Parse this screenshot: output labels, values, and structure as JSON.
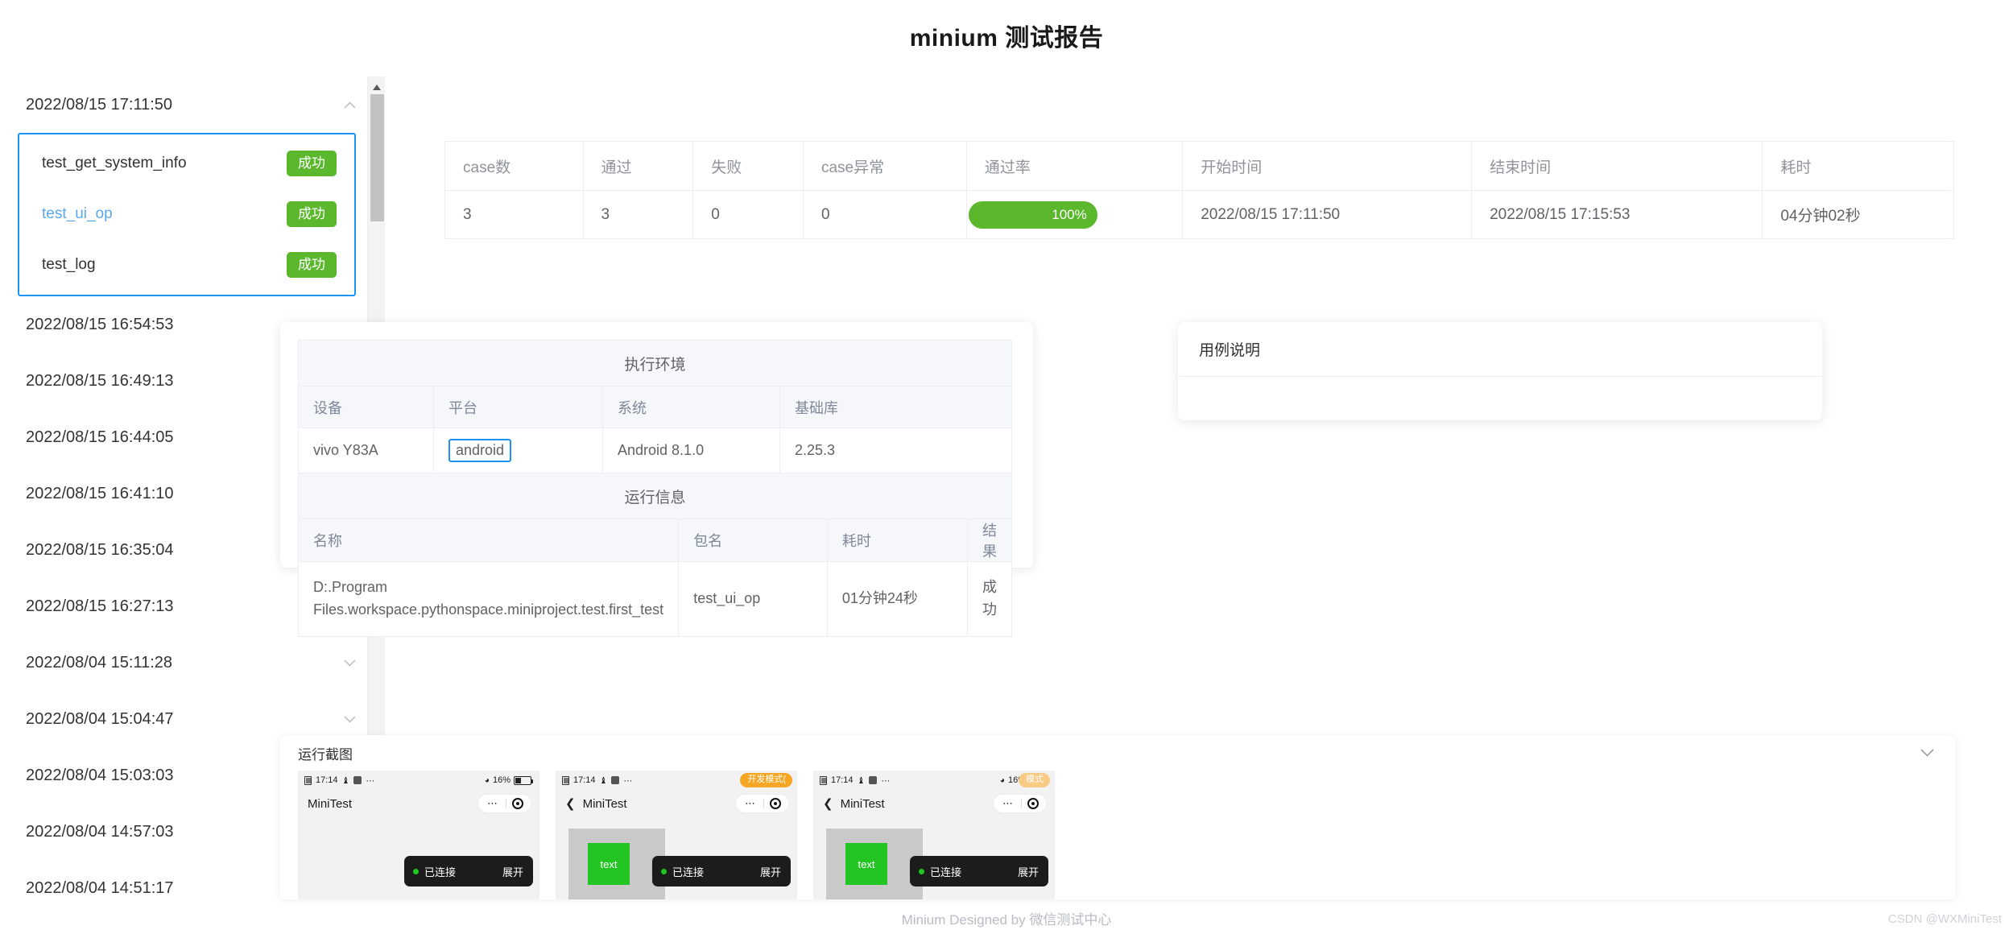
{
  "header": {
    "title": "minium 测试报告"
  },
  "sidebar": {
    "groups": [
      {
        "timestamp": "2022/08/15 17:11:50",
        "expanded": true,
        "icon": "chevron-up-icon",
        "cases": [
          {
            "name": "test_get_system_info",
            "status": "成功"
          },
          {
            "name": "test_ui_op",
            "status": "成功"
          },
          {
            "name": "test_log",
            "status": "成功"
          }
        ]
      },
      {
        "timestamp": "2022/08/15 16:54:53",
        "expanded": false,
        "icon": "chevron-down-icon"
      },
      {
        "timestamp": "2022/08/15 16:49:13",
        "expanded": false,
        "icon": "chevron-down-icon"
      },
      {
        "timestamp": "2022/08/15 16:44:05",
        "expanded": false,
        "icon": "chevron-down-icon"
      },
      {
        "timestamp": "2022/08/15 16:41:10",
        "expanded": false,
        "icon": "chevron-down-icon"
      },
      {
        "timestamp": "2022/08/15 16:35:04",
        "expanded": false,
        "icon": "chevron-down-icon"
      },
      {
        "timestamp": "2022/08/15 16:27:13",
        "expanded": false,
        "icon": "chevron-down-icon"
      },
      {
        "timestamp": "2022/08/04 15:11:28",
        "expanded": false,
        "icon": "chevron-down-icon"
      },
      {
        "timestamp": "2022/08/04 15:04:47",
        "expanded": false,
        "icon": "chevron-down-icon"
      },
      {
        "timestamp": "2022/08/04 15:03:03",
        "expanded": false,
        "icon": "chevron-down-icon"
      },
      {
        "timestamp": "2022/08/04 14:57:03",
        "expanded": false,
        "icon": "chevron-down-icon"
      },
      {
        "timestamp": "2022/08/04 14:51:17",
        "expanded": false,
        "icon": "chevron-down-icon"
      }
    ],
    "scrollbar": {
      "up_icon": "scroll-up-arrow-icon",
      "down_icon": "scroll-down-arrow-icon"
    }
  },
  "summary": {
    "columns": [
      "case数",
      "通过",
      "失败",
      "case异常",
      "通过率",
      "开始时间",
      "结束时间",
      "耗时"
    ],
    "row": {
      "case_count": "3",
      "passed": "3",
      "failed": "0",
      "error": "0",
      "pass_rate": "100%",
      "pass_rate_value": 100,
      "start_time": "2022/08/15 17:11:50",
      "end_time": "2022/08/15 17:15:53",
      "duration": "04分钟02秒"
    }
  },
  "env_card": {
    "env_title": "执行环境",
    "env_columns": [
      "设备",
      "平台",
      "系统",
      "基础库"
    ],
    "env_row": {
      "device": "vivo Y83A",
      "platform": "android",
      "system": "Android 8.1.0",
      "base_lib": "2.25.3"
    },
    "run_title": "运行信息",
    "run_columns": [
      "名称",
      "包名",
      "耗时",
      "结果"
    ],
    "run_row": {
      "name": "D:.Program Files.workspace.pythonspace.miniproject.test.first_test",
      "package": "test_ui_op",
      "duration": "01分钟24秒",
      "result": "成功"
    }
  },
  "note_card": {
    "title": "用例说明",
    "body": ""
  },
  "screenshots": {
    "section_title": "运行截图",
    "collapse_icon": "chevron-down-icon",
    "items": [
      {
        "status_time": "17:14",
        "battery": "16%",
        "app_title": "MiniTest",
        "has_back": false,
        "badge": "",
        "block_text": "",
        "toast_status": "已连接",
        "toast_action": "展开"
      },
      {
        "status_time": "17:14",
        "battery": "",
        "app_title": "MiniTest",
        "has_back": true,
        "badge": "开发模式(",
        "block_text": "text",
        "toast_status": "已连接",
        "toast_action": "展开"
      },
      {
        "status_time": "17:14",
        "battery": "16%",
        "app_title": "MiniTest",
        "has_back": true,
        "badge": "模式",
        "block_text": "text",
        "toast_status": "已连接",
        "toast_action": "展开"
      }
    ]
  },
  "footer": {
    "text": "Minium Designed by 微信测试中心"
  },
  "watermark": {
    "text": "CSDN @WXMiniTest"
  },
  "colors": {
    "accent": "#1c93f0",
    "success": "#5bb82d",
    "warning": "#f5a623",
    "link": "#5aa9f0"
  }
}
